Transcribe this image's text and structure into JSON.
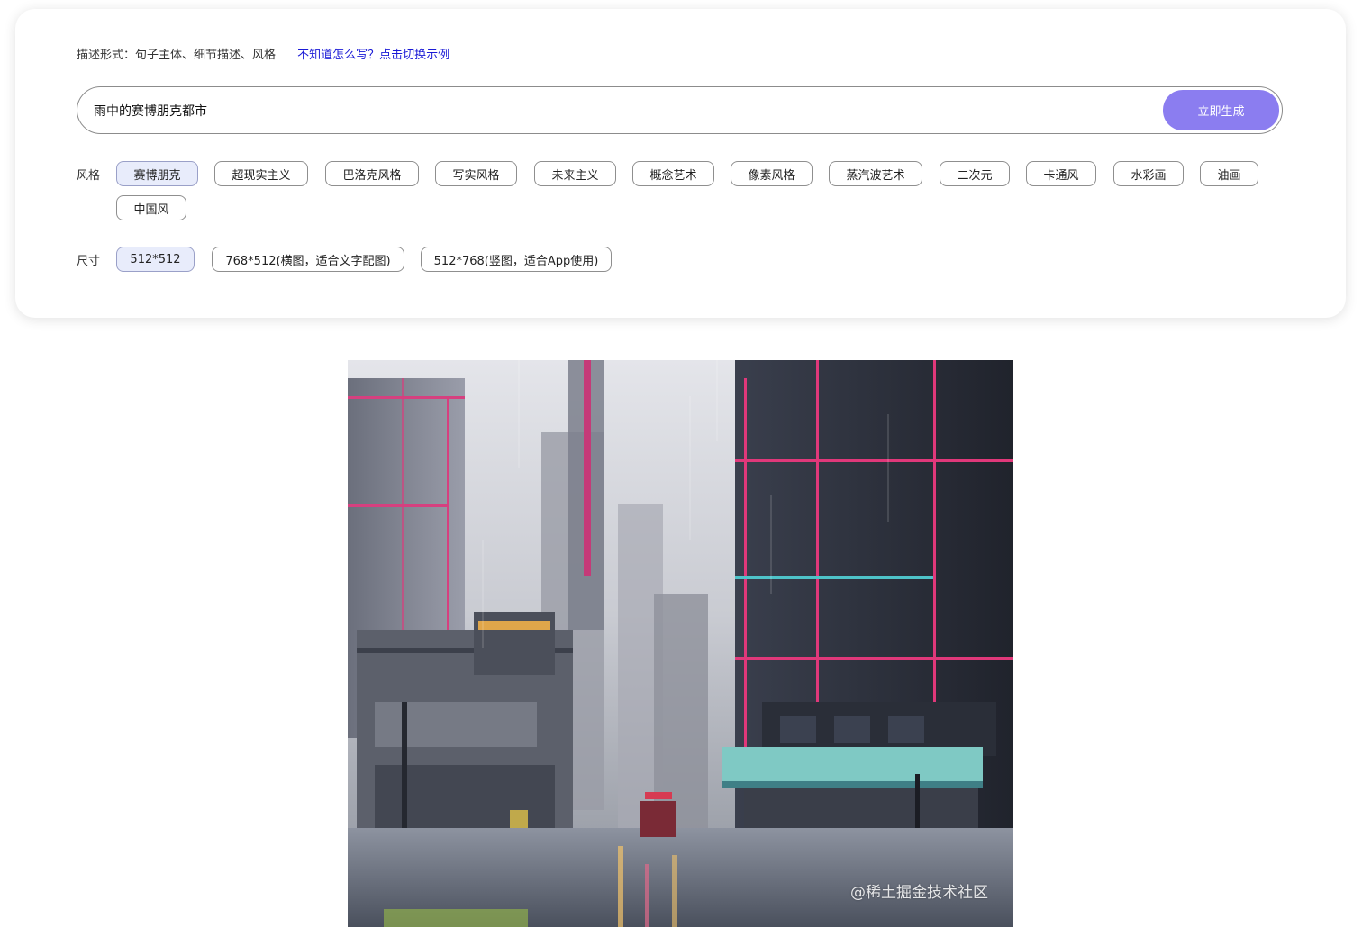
{
  "header": {
    "hint_label": "描述形式：句子主体、细节描述、风格",
    "hint_link": "不知道怎么写？点击切换示例"
  },
  "prompt": {
    "value": "雨中的赛博朋克都市",
    "button_label": "立即生成"
  },
  "style_section": {
    "label": "风格",
    "options": [
      "赛博朋克",
      "超现实主义",
      "巴洛克风格",
      "写实风格",
      "未来主义",
      "概念艺术",
      "像素风格",
      "蒸汽波艺术",
      "二次元",
      "卡通风",
      "水彩画",
      "油画",
      "中国风"
    ],
    "selected": "赛博朋克"
  },
  "size_section": {
    "label": "尺寸",
    "options": [
      "512*512",
      "768*512(横图，适合文字配图)",
      "512*768(竖图，适合App使用)"
    ],
    "selected": "512*512"
  },
  "result": {
    "image_description": "cyberpunk-city-in-rain"
  },
  "watermark": "@稀土掘金技术社区",
  "colors": {
    "accent": "#8b7df0",
    "link": "#1a1ad6",
    "selected_chip_bg": "#e8ecfb"
  }
}
